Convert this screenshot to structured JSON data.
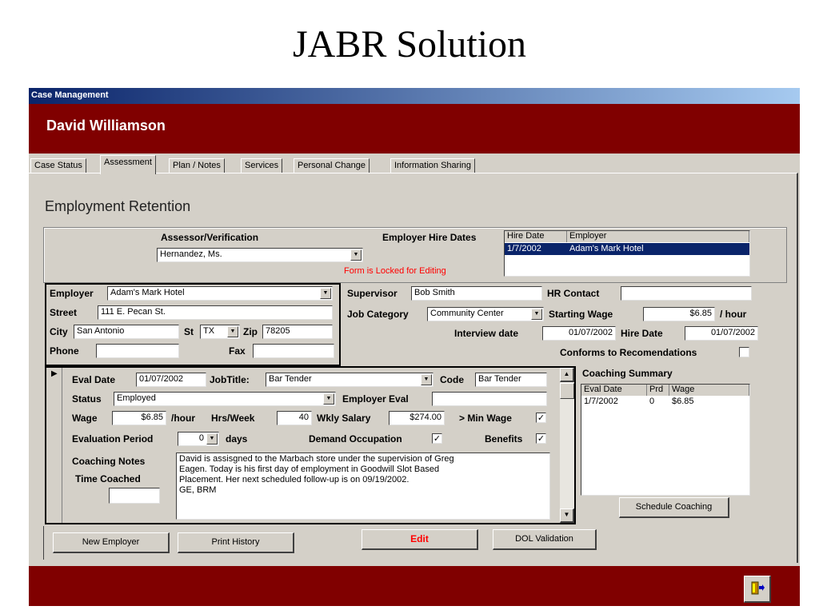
{
  "slide": {
    "title": "JABR Solution"
  },
  "window": {
    "title": "Case Management",
    "client_name": "David Williamson"
  },
  "tabs": [
    {
      "label": "Case Status"
    },
    {
      "label": "Assessment"
    },
    {
      "label": "Plan / Notes"
    },
    {
      "label": "Services"
    },
    {
      "label": "Personal Change"
    },
    {
      "label": "Information Sharing"
    }
  ],
  "section": {
    "title": "Employment Retention"
  },
  "assessor": {
    "label": "Assessor/Verification",
    "value": "Hernandez, Ms.",
    "locked_text": "Form is Locked for Editing"
  },
  "hire_dates": {
    "label": "Employer Hire Dates",
    "columns": [
      "Hire Date",
      "Employer"
    ],
    "rows": [
      {
        "hire_date": "1/7/2002",
        "employer": "Adam's Mark Hotel"
      }
    ]
  },
  "employer": {
    "employer_label": "Employer",
    "employer_value": "Adam's Mark Hotel",
    "street_label": "Street",
    "street_value": "111 E. Pecan St.",
    "city_label": "City",
    "city_value": "San Antonio",
    "st_label": "St",
    "st_value": "TX",
    "zip_label": "Zip",
    "zip_value": "78205",
    "phone_label": "Phone",
    "phone_value": "",
    "fax_label": "Fax",
    "fax_value": ""
  },
  "job": {
    "supervisor_label": "Supervisor",
    "supervisor_value": "Bob Smith",
    "hr_label": "HR Contact",
    "hr_value": "",
    "category_label": "Job Category",
    "category_value": "Community Center",
    "starting_wage_label": "Starting Wage",
    "starting_wage_value": "$6.85",
    "hour_label": "/ hour",
    "interview_label": "Interview date",
    "interview_value": "01/07/2002",
    "hire_label": "Hire Date",
    "hire_value": "01/07/2002",
    "conforms_label": "Conforms to Recomendations",
    "conforms_checked": ""
  },
  "eval": {
    "eval_date_label": "Eval Date",
    "eval_date_value": "01/07/2002",
    "jobtitle_label": "JobTitle:",
    "jobtitle_value": "Bar Tender",
    "code_label": "Code",
    "code_value": "Bar Tender",
    "status_label": "Status",
    "status_value": "Employed",
    "employer_eval_label": "Employer Eval",
    "employer_eval_value": "",
    "wage_label": "Wage",
    "wage_value": "$6.85",
    "per_hour": "/hour",
    "hrs_label": "Hrs/Week",
    "hrs_value": "40",
    "salary_label": "Wkly Salary",
    "salary_value": "$274.00",
    "minwage_label": "> Min Wage",
    "minwage_checked": "✓",
    "period_label": "Evaluation Period",
    "period_value": "0",
    "days_label": "days",
    "demand_label": "Demand Occupation",
    "demand_checked": "✓",
    "benefits_label": "Benefits",
    "benefits_checked": "✓",
    "notes_label": "Coaching Notes",
    "notes_lines": [
      "David is assisgned to the Marbach store under the supervision of Greg",
      "Eagen.  Today is his first day of employment in Goodwill Slot Based",
      "Placement.  Her next scheduled follow-up is on 09/19/2002.",
      "GE, BRM"
    ],
    "time_label": "Time Coached",
    "time_value": ""
  },
  "coaching": {
    "title": "Coaching Summary",
    "columns": [
      "Eval Date",
      "Prd",
      "Wage"
    ],
    "rows": [
      {
        "date": "1/7/2002",
        "prd": "0",
        "wage": "$6.85"
      }
    ],
    "schedule_button": "Schedule Coaching"
  },
  "buttons": {
    "new_employer": "New Employer",
    "print_history": "Print History",
    "edit": "Edit",
    "dol": "DOL Validation"
  },
  "colors": {
    "banner": "#800000",
    "titlebar": "#0a246a",
    "face": "#d4d0c8",
    "locked": "#ff0000"
  }
}
